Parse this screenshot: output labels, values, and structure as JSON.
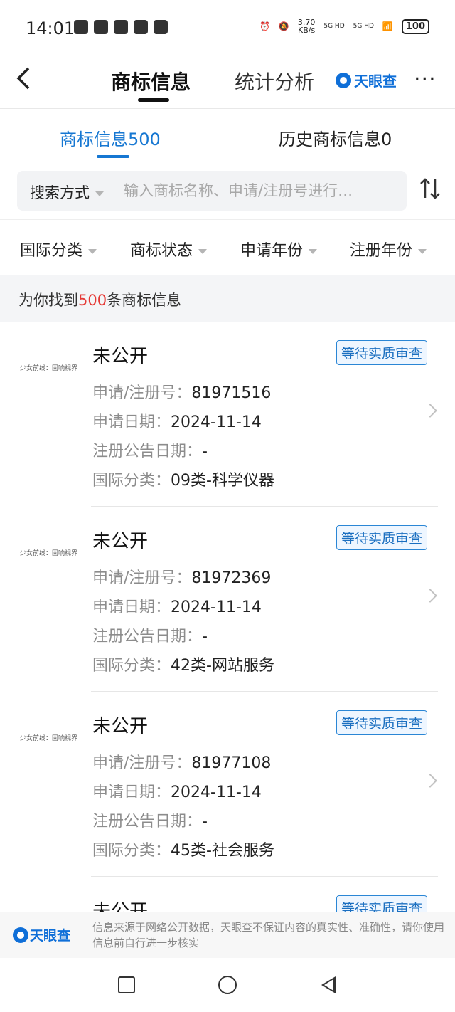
{
  "status_bar": {
    "time": "14:01",
    "speed": "3.70",
    "speed_unit": "KB/s",
    "sim1": "5G HD",
    "sim2": "5G HD",
    "battery": "100"
  },
  "nav": {
    "tab_active": "商标信息",
    "tab_inactive": "统计分析",
    "brand": "天眼查",
    "more": "···"
  },
  "subtabs": {
    "active": "商标信息500",
    "inactive": "历史商标信息0"
  },
  "search": {
    "method": "搜索方式",
    "placeholder": "输入商标名称、申请/注册号进行…"
  },
  "filters": [
    "国际分类",
    "商标状态",
    "申请年份",
    "注册年份"
  ],
  "result": {
    "prefix": "为你找到",
    "count": "500",
    "suffix": "条商标信息"
  },
  "labels": {
    "reg_no": "申请/注册号：",
    "apply_date": "申请日期：",
    "pub_date": "注册公告日期：",
    "intl_class": "国际分类："
  },
  "trademarks": [
    {
      "logo_text": "少女前线：回响视界",
      "name": "未公开",
      "status": "等待实质审查",
      "reg_no": "81971516",
      "apply_date": "2024-11-14",
      "pub_date": "-",
      "intl_class": "09类-科学仪器"
    },
    {
      "logo_text": "少女前线：回响视界",
      "name": "未公开",
      "status": "等待实质审查",
      "reg_no": "81972369",
      "apply_date": "2024-11-14",
      "pub_date": "-",
      "intl_class": "42类-网站服务"
    },
    {
      "logo_text": "少女前线：回响视界",
      "name": "未公开",
      "status": "等待实质审查",
      "reg_no": "81977108",
      "apply_date": "2024-11-14",
      "pub_date": "-",
      "intl_class": "45类-社会服务"
    },
    {
      "name": "未公开",
      "status": "等待实质审查"
    }
  ],
  "footer": {
    "brand": "天眼查",
    "disclaimer": "信息来源于网络公开数据，天眼查不保证内容的真实性、准确性，请你使用信息前自行进一步核实"
  },
  "colors": {
    "accent": "#1677d2",
    "highlight": "#e53935",
    "brand": "#0f6fd8"
  }
}
